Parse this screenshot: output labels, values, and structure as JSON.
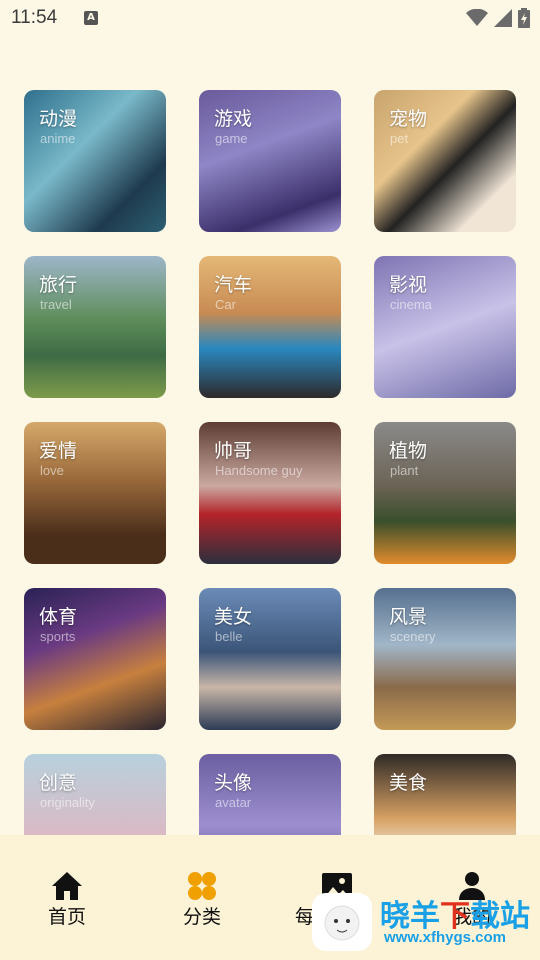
{
  "status": {
    "time": "11:54",
    "notification_icon": "A"
  },
  "categories": [
    {
      "name": "动漫",
      "en": "anime"
    },
    {
      "name": "游戏",
      "en": "game"
    },
    {
      "name": "宠物",
      "en": "pet"
    },
    {
      "name": "旅行",
      "en": "travel"
    },
    {
      "name": "汽车",
      "en": "Car"
    },
    {
      "name": "影视",
      "en": "cinema"
    },
    {
      "name": "爱情",
      "en": "love"
    },
    {
      "name": "帅哥",
      "en": "Handsome guy"
    },
    {
      "name": "植物",
      "en": "plant"
    },
    {
      "name": "体育",
      "en": "sports"
    },
    {
      "name": "美女",
      "en": "belle"
    },
    {
      "name": "风景",
      "en": "scenery"
    },
    {
      "name": "创意",
      "en": "originality"
    },
    {
      "name": "头像",
      "en": "avatar"
    },
    {
      "name": "美食",
      "en": ""
    }
  ],
  "nav": {
    "home": "首页",
    "category": "分类",
    "daily": "每",
    "mine": "我的",
    "active_color": "#f0a000"
  },
  "watermark": {
    "logo": "晓羊",
    "brand_blue": "晓羊",
    "brand_red": "下",
    "brand_blue2": "载站",
    "url": "www.xfhygs.com"
  }
}
